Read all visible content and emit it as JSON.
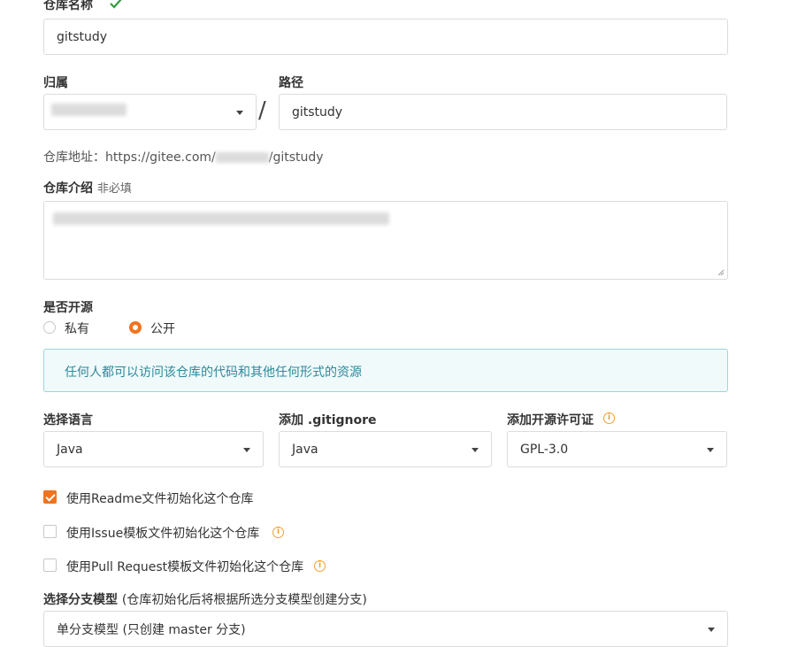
{
  "repo_name": {
    "label": "仓库名称",
    "value": "gitstudy"
  },
  "owner": {
    "label": "归属"
  },
  "path": {
    "label": "路径",
    "value": "gitstudy",
    "separator": "/"
  },
  "repo_url": {
    "prefix": "仓库地址：https://gitee.com/",
    "suffix": "/gitstudy"
  },
  "intro": {
    "label": "仓库介绍",
    "hint": "非必填"
  },
  "visibility": {
    "label": "是否开源",
    "options": [
      "私有",
      "公开"
    ],
    "selected": "公开",
    "notice": "任何人都可以访问该仓库的代码和其他任何形式的资源"
  },
  "language": {
    "label": "选择语言",
    "value": "Java"
  },
  "gitignore": {
    "label": "添加 .gitignore",
    "value": "Java"
  },
  "license": {
    "label": "添加开源许可证",
    "value": "GPL-3.0"
  },
  "init_options": [
    {
      "label": "使用Readme文件初始化这个仓库",
      "checked": true
    },
    {
      "label": "使用Issue模板文件初始化这个仓库",
      "checked": false
    },
    {
      "label": "使用Pull Request模板文件初始化这个仓库",
      "checked": false
    }
  ],
  "branch_model": {
    "label": "选择分支模型",
    "hint": "(仓库初始化后将根据所选分支模型创建分支)",
    "value": "单分支模型 (只创建 master 分支)"
  },
  "colors": {
    "accent": "#f0731e",
    "check": "#2e9e3e",
    "notice_bg": "#f0fafb",
    "notice_border": "#9ed3de",
    "notice_text": "#2b8a9b"
  },
  "icons": [
    "check-icon",
    "caret-down-icon",
    "info-icon"
  ]
}
